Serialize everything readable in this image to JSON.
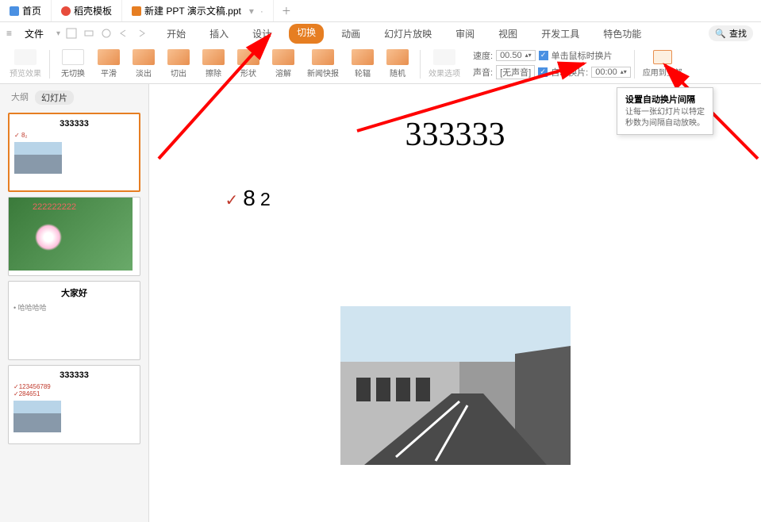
{
  "tabs": {
    "home": "首页",
    "daoke": "稻壳模板",
    "newdoc": "新建 PPT 演示文稿.ppt"
  },
  "menu": {
    "file": "文件",
    "items": [
      "开始",
      "插入",
      "设计",
      "切换",
      "动画",
      "幻灯片放映",
      "审阅",
      "视图",
      "开发工具",
      "特色功能"
    ],
    "active_index": 3,
    "search_icon": "🔍",
    "search_label": "查找"
  },
  "ribbon": {
    "preview": "预览效果",
    "transitions": [
      "无切换",
      "平滑",
      "淡出",
      "切出",
      "擦除",
      "形状",
      "溶解",
      "新闻快报",
      "轮辐",
      "随机"
    ],
    "effect_options": "效果选项",
    "speed_label": "速度:",
    "speed_value": "00.50",
    "sound_label": "声音:",
    "sound_value": "[无声音]",
    "advance_click": "单击鼠标时换片",
    "advance_auto": "自动换片:",
    "advance_time": "00:00",
    "apply_all": "应用到全部"
  },
  "panel": {
    "outline_tab": "大纲",
    "slides_tab": "幻灯片",
    "thumbs": [
      {
        "title": "333333",
        "bullet": "8₂"
      },
      {
        "title": "",
        "overlay": "222222222"
      },
      {
        "title": "大家好",
        "bullet": "哈哈哈哈"
      },
      {
        "title": "333333",
        "b1": "123456789",
        "b2": "284651"
      }
    ]
  },
  "slide": {
    "title": "333333",
    "bullet": "8",
    "sub": "2"
  },
  "tooltip": {
    "title": "设置自动换片间隔",
    "line1": "让每一张幻灯片以特定",
    "line2": "秒数为间隔自动放映。"
  }
}
